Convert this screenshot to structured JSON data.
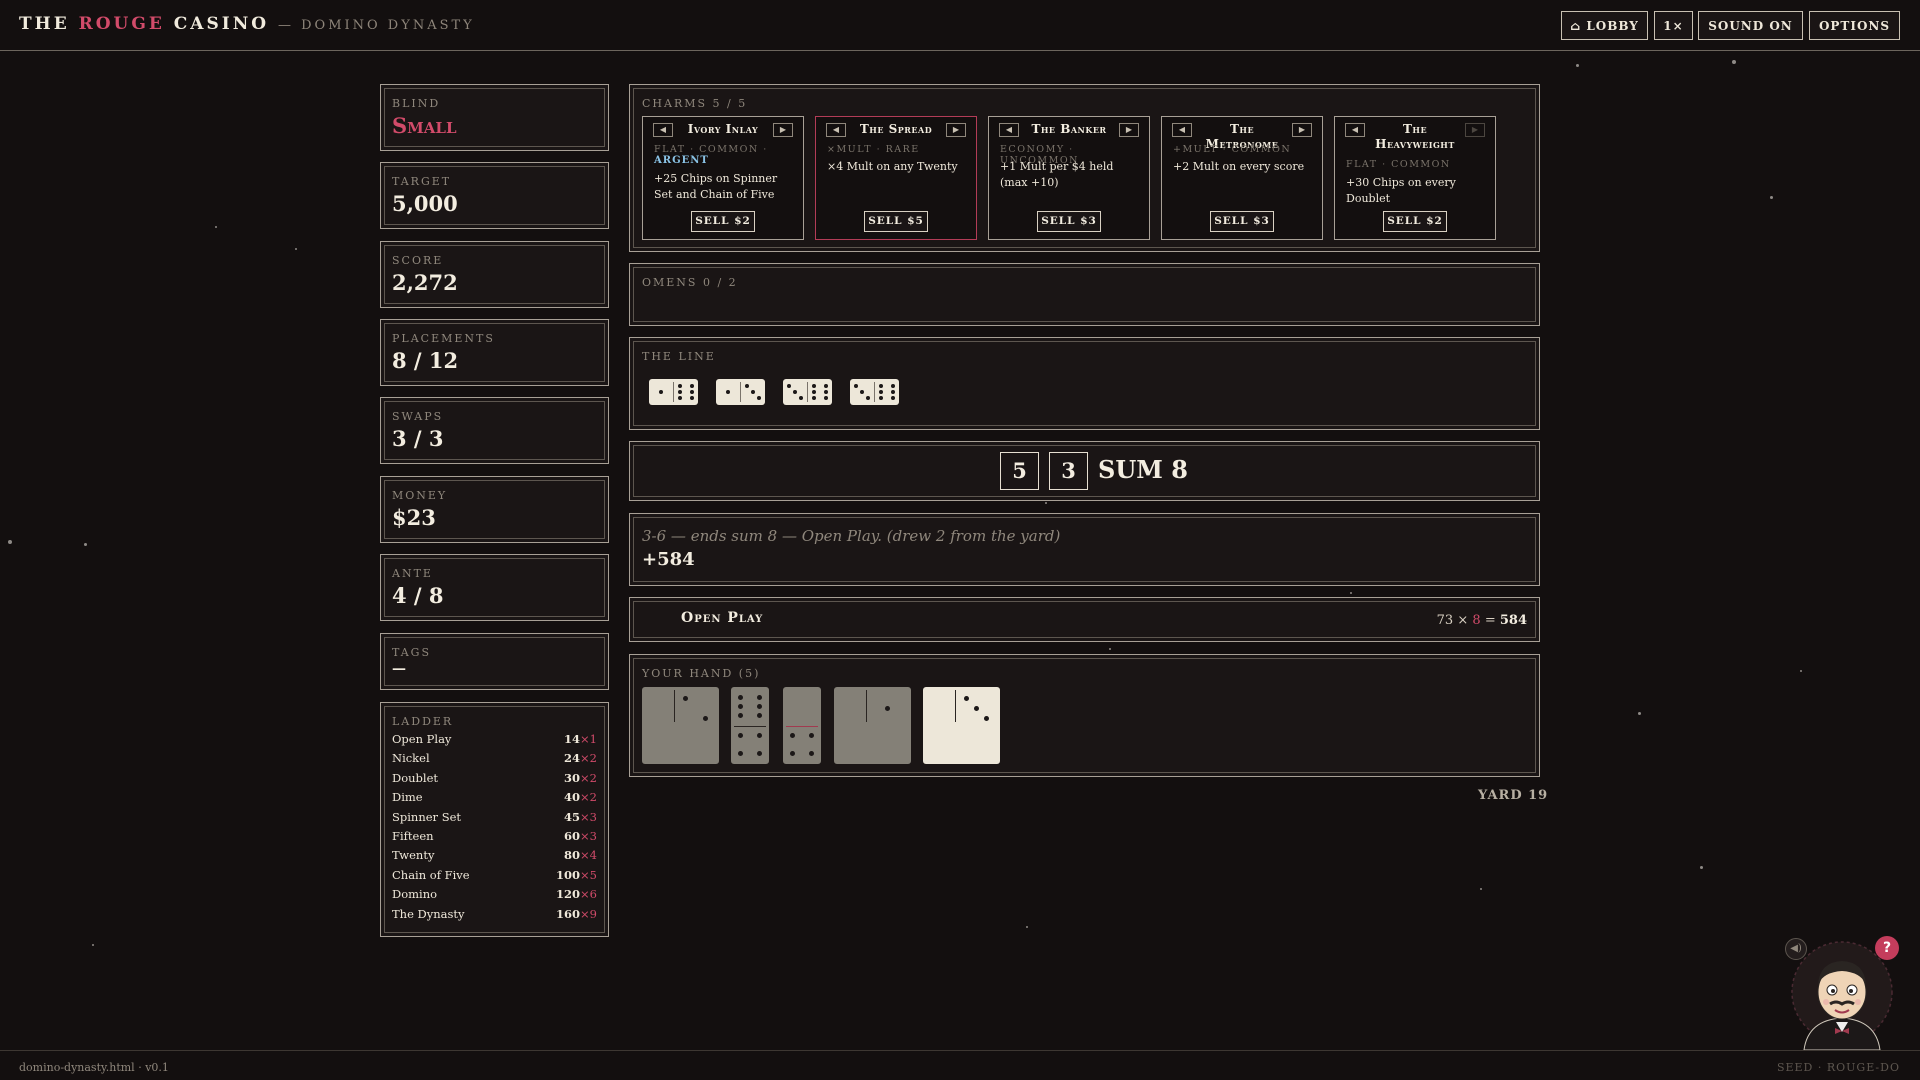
{
  "header": {
    "brand_the": "THE",
    "brand_rouge": "ROUGE",
    "brand_casino": "CASINO",
    "brand_sub": "— DOMINO DYNASTY",
    "buttons": {
      "lobby": "⌂ LOBBY",
      "speed": "1×",
      "sound": "SOUND ON",
      "options": "OPTIONS"
    }
  },
  "stats": {
    "blind": {
      "label": "BLIND",
      "value": "Small"
    },
    "target": {
      "label": "TARGET",
      "value": "5,000"
    },
    "score": {
      "label": "SCORE",
      "value": "2,272"
    },
    "placements": {
      "label": "PLACEMENTS",
      "value": "8 / 12"
    },
    "swaps": {
      "label": "SWAPS",
      "value": "3 / 3"
    },
    "money": {
      "label": "MONEY",
      "value": "$23"
    },
    "ante": {
      "label": "ANTE",
      "value": "4 / 8"
    },
    "tags": {
      "label": "TAGS",
      "value": "—"
    }
  },
  "ladder": {
    "label": "LADDER",
    "rows": [
      {
        "name": "Open Play",
        "chips": "14",
        "mult": "×1"
      },
      {
        "name": "Nickel",
        "chips": "24",
        "mult": "×2"
      },
      {
        "name": "Doublet",
        "chips": "30",
        "mult": "×2"
      },
      {
        "name": "Dime",
        "chips": "40",
        "mult": "×2"
      },
      {
        "name": "Spinner Set",
        "chips": "45",
        "mult": "×3"
      },
      {
        "name": "Fifteen",
        "chips": "60",
        "mult": "×3"
      },
      {
        "name": "Twenty",
        "chips": "80",
        "mult": "×4"
      },
      {
        "name": "Chain of Five",
        "chips": "100",
        "mult": "×5"
      },
      {
        "name": "Domino",
        "chips": "120",
        "mult": "×6"
      },
      {
        "name": "The Dynasty",
        "chips": "160",
        "mult": "×9"
      }
    ]
  },
  "charms": {
    "label": "CHARMS 5 / 5",
    "cards": [
      {
        "name": "Ivory Inlay",
        "meta": "FLAT · COMMON ·",
        "edition": "ARGENT",
        "desc": "+25 Chips on Spinner Set and Chain of Five",
        "sell": "SELL $2"
      },
      {
        "name": "The Spread",
        "meta": "×MULT · RARE",
        "desc": "×4 Mult on any Twenty",
        "sell": "SELL $5"
      },
      {
        "name": "The Banker",
        "meta": "ECONOMY · UNCOMMON",
        "desc": "+1 Mult per $4 held (max +10)",
        "sell": "SELL $3"
      },
      {
        "name": "The Metronome",
        "meta": "+MULT · COMMON",
        "desc": "+2 Mult on every score",
        "sell": "SELL $3"
      },
      {
        "name": "The Heavyweight",
        "meta": "FLAT · COMMON",
        "desc": "+30 Chips on every Doublet",
        "sell": "SELL $2"
      }
    ]
  },
  "omens": {
    "label": "OMENS 0 / 2"
  },
  "line": {
    "label": "THE LINE",
    "dominoes": [
      [
        1,
        6
      ],
      [
        1,
        3
      ],
      [
        3,
        6
      ],
      [
        3,
        6
      ]
    ]
  },
  "ends": {
    "left": "5",
    "right": "3",
    "sum_label": "SUM",
    "sum_value": "8"
  },
  "log": {
    "message": "3-6 — ends sum 8 — Open Play. (drew 2 from the yard)",
    "gain": "+584"
  },
  "hand_result": {
    "name": "Open Play",
    "chips": "73",
    "times": "×",
    "mult": "8",
    "equals": "=",
    "total": "584"
  },
  "hand": {
    "label": "YOUR HAND (5)",
    "dominoes": [
      [
        0,
        2
      ],
      [
        6,
        4
      ],
      [
        0,
        4
      ],
      [
        0,
        1
      ],
      [
        0,
        3
      ]
    ],
    "selected_index": 4
  },
  "yard": "YARD 19",
  "footer": {
    "left": "domino-dynasty.html · v0.1",
    "right": "SEED · ROUGE-DO"
  },
  "widgets": {
    "mute_icon": "speaker-icon",
    "help": "?"
  },
  "colors": {
    "accent": "#d24b6a",
    "edition": "#8ac3e6",
    "background": "#130f0f"
  }
}
